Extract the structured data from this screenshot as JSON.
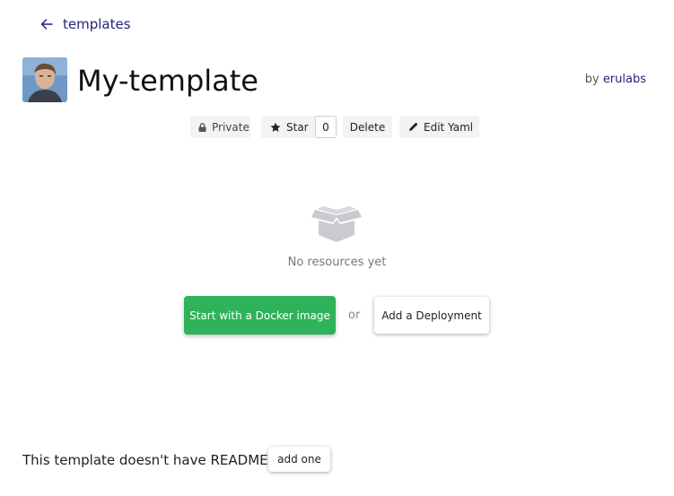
{
  "nav": {
    "back_label": "templates",
    "back_icon": "arrow-left-icon"
  },
  "header": {
    "title": "My-template",
    "by_label": "by",
    "owner": "erulabs",
    "avatar_icon": "user-avatar"
  },
  "toolbar": {
    "private_label": "Private",
    "star_label": "Star",
    "star_count": "0",
    "delete_label": "Delete",
    "edit_yaml_label": "Edit Yaml"
  },
  "empty_state": {
    "icon": "open-box-icon",
    "message": "No resources yet",
    "docker_button": "Start with a Docker image",
    "or_text": "or",
    "deployment_button": "Add a Deployment"
  },
  "readme": {
    "message": "This template doesn't have README.",
    "add_button": "add one"
  },
  "colors": {
    "link": "#24237a",
    "primary_green": "#2fb35a",
    "toolbar_bg": "#f3f3f3",
    "muted_text": "#777777",
    "empty_icon": "#c9cbd1"
  }
}
